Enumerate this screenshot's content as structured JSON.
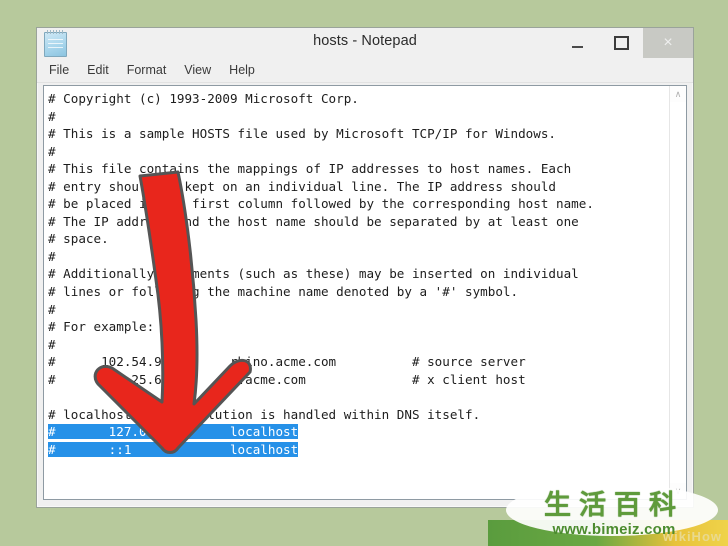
{
  "desktop": {
    "background_color": "#b7c99c"
  },
  "window": {
    "title": "hosts - Notepad",
    "icon": "notepad-icon",
    "controls": {
      "minimize": "–",
      "maximize": "□",
      "close": "×"
    },
    "menu": [
      {
        "label": "File"
      },
      {
        "label": "Edit"
      },
      {
        "label": "Format"
      },
      {
        "label": "View"
      },
      {
        "label": "Help"
      }
    ],
    "scrollbar": {
      "up_arrow": "∧",
      "down_arrow": "∨"
    }
  },
  "editor": {
    "selection_color": "#2691e8",
    "selection_text_color": "#ffffff",
    "lines_before_selection": "# Copyright (c) 1993-2009 Microsoft Corp.\n#\n# This is a sample HOSTS file used by Microsoft TCP/IP for Windows.\n#\n# This file contains the mappings of IP addresses to host names. Each\n# entry should be kept on an individual line. The IP address should\n# be placed in the first column followed by the corresponding host name.\n# The IP address and the host name should be separated by at least one\n# space.\n#\n# Additionally, comments (such as these) may be inserted on individual\n# lines or following the machine name denoted by a '#' symbol.\n#\n# For example:\n#\n#      102.54.94.97     rhino.acme.com          # source server\n#       38.25.63.10     x.acme.com              # x client host\n\n# localhost name resolution is handled within DNS itself.\n",
    "selected_line_1": "#       127.0.0.1       localhost",
    "selected_line_2": "#       ::1             localhost"
  },
  "annotation": {
    "arrow": "red-down-arrow",
    "arrow_color": "#e8261c",
    "arrow_outline_color": "#4a4a4a"
  },
  "watermark": {
    "cjk_text": "生活百科",
    "url": "www.bimeiz.com",
    "ghost_text": "wikiHow",
    "band_colors": [
      "#5a9c3e",
      "#efd34a"
    ]
  }
}
